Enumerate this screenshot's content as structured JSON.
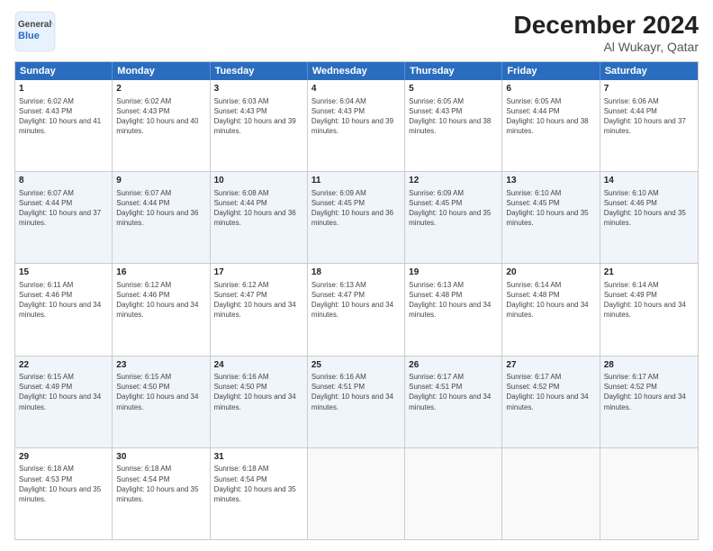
{
  "header": {
    "logo_line1": "General",
    "logo_line2": "Blue",
    "title": "December 2024",
    "subtitle": "Al Wukayr, Qatar"
  },
  "days_of_week": [
    "Sunday",
    "Monday",
    "Tuesday",
    "Wednesday",
    "Thursday",
    "Friday",
    "Saturday"
  ],
  "weeks": [
    [
      {
        "day": "1",
        "sunrise": "6:02 AM",
        "sunset": "4:43 PM",
        "daylight": "10 hours and 41 minutes."
      },
      {
        "day": "2",
        "sunrise": "6:02 AM",
        "sunset": "4:43 PM",
        "daylight": "10 hours and 40 minutes."
      },
      {
        "day": "3",
        "sunrise": "6:03 AM",
        "sunset": "4:43 PM",
        "daylight": "10 hours and 39 minutes."
      },
      {
        "day": "4",
        "sunrise": "6:04 AM",
        "sunset": "4:43 PM",
        "daylight": "10 hours and 39 minutes."
      },
      {
        "day": "5",
        "sunrise": "6:05 AM",
        "sunset": "4:43 PM",
        "daylight": "10 hours and 38 minutes."
      },
      {
        "day": "6",
        "sunrise": "6:05 AM",
        "sunset": "4:44 PM",
        "daylight": "10 hours and 38 minutes."
      },
      {
        "day": "7",
        "sunrise": "6:06 AM",
        "sunset": "4:44 PM",
        "daylight": "10 hours and 37 minutes."
      }
    ],
    [
      {
        "day": "8",
        "sunrise": "6:07 AM",
        "sunset": "4:44 PM",
        "daylight": "10 hours and 37 minutes."
      },
      {
        "day": "9",
        "sunrise": "6:07 AM",
        "sunset": "4:44 PM",
        "daylight": "10 hours and 36 minutes."
      },
      {
        "day": "10",
        "sunrise": "6:08 AM",
        "sunset": "4:44 PM",
        "daylight": "10 hours and 36 minutes."
      },
      {
        "day": "11",
        "sunrise": "6:09 AM",
        "sunset": "4:45 PM",
        "daylight": "10 hours and 36 minutes."
      },
      {
        "day": "12",
        "sunrise": "6:09 AM",
        "sunset": "4:45 PM",
        "daylight": "10 hours and 35 minutes."
      },
      {
        "day": "13",
        "sunrise": "6:10 AM",
        "sunset": "4:45 PM",
        "daylight": "10 hours and 35 minutes."
      },
      {
        "day": "14",
        "sunrise": "6:10 AM",
        "sunset": "4:46 PM",
        "daylight": "10 hours and 35 minutes."
      }
    ],
    [
      {
        "day": "15",
        "sunrise": "6:11 AM",
        "sunset": "4:46 PM",
        "daylight": "10 hours and 34 minutes."
      },
      {
        "day": "16",
        "sunrise": "6:12 AM",
        "sunset": "4:46 PM",
        "daylight": "10 hours and 34 minutes."
      },
      {
        "day": "17",
        "sunrise": "6:12 AM",
        "sunset": "4:47 PM",
        "daylight": "10 hours and 34 minutes."
      },
      {
        "day": "18",
        "sunrise": "6:13 AM",
        "sunset": "4:47 PM",
        "daylight": "10 hours and 34 minutes."
      },
      {
        "day": "19",
        "sunrise": "6:13 AM",
        "sunset": "4:48 PM",
        "daylight": "10 hours and 34 minutes."
      },
      {
        "day": "20",
        "sunrise": "6:14 AM",
        "sunset": "4:48 PM",
        "daylight": "10 hours and 34 minutes."
      },
      {
        "day": "21",
        "sunrise": "6:14 AM",
        "sunset": "4:49 PM",
        "daylight": "10 hours and 34 minutes."
      }
    ],
    [
      {
        "day": "22",
        "sunrise": "6:15 AM",
        "sunset": "4:49 PM",
        "daylight": "10 hours and 34 minutes."
      },
      {
        "day": "23",
        "sunrise": "6:15 AM",
        "sunset": "4:50 PM",
        "daylight": "10 hours and 34 minutes."
      },
      {
        "day": "24",
        "sunrise": "6:16 AM",
        "sunset": "4:50 PM",
        "daylight": "10 hours and 34 minutes."
      },
      {
        "day": "25",
        "sunrise": "6:16 AM",
        "sunset": "4:51 PM",
        "daylight": "10 hours and 34 minutes."
      },
      {
        "day": "26",
        "sunrise": "6:17 AM",
        "sunset": "4:51 PM",
        "daylight": "10 hours and 34 minutes."
      },
      {
        "day": "27",
        "sunrise": "6:17 AM",
        "sunset": "4:52 PM",
        "daylight": "10 hours and 34 minutes."
      },
      {
        "day": "28",
        "sunrise": "6:17 AM",
        "sunset": "4:52 PM",
        "daylight": "10 hours and 34 minutes."
      }
    ],
    [
      {
        "day": "29",
        "sunrise": "6:18 AM",
        "sunset": "4:53 PM",
        "daylight": "10 hours and 35 minutes."
      },
      {
        "day": "30",
        "sunrise": "6:18 AM",
        "sunset": "4:54 PM",
        "daylight": "10 hours and 35 minutes."
      },
      {
        "day": "31",
        "sunrise": "6:18 AM",
        "sunset": "4:54 PM",
        "daylight": "10 hours and 35 minutes."
      },
      null,
      null,
      null,
      null
    ]
  ],
  "labels": {
    "sunrise": "Sunrise:",
    "sunset": "Sunset:",
    "daylight": "Daylight:"
  }
}
